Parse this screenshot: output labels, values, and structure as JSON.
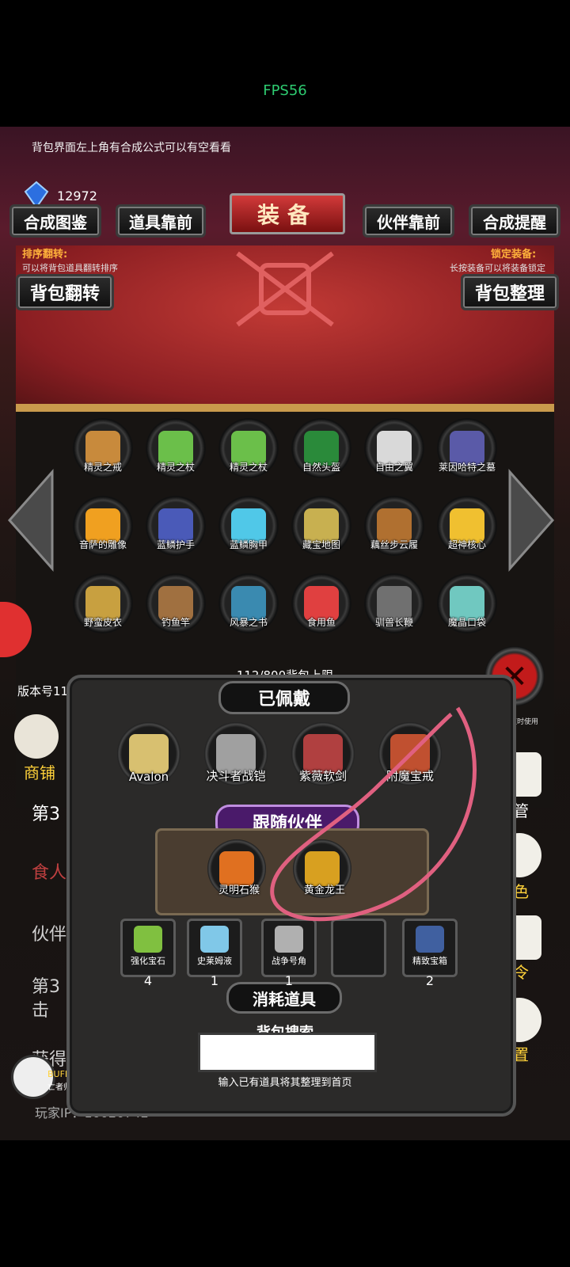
{
  "status_bar": {
    "fps": "FPS56"
  },
  "hint": "背包界面左上角有合成公式可以有空看看",
  "currency": {
    "amount": "12972",
    "icon": "blue-gem-icon"
  },
  "title": "装备",
  "tabs": {
    "recipe": "合成图鉴",
    "items_front": "道具靠前",
    "partners_front": "伙伴靠前",
    "craft_remind": "合成提醒"
  },
  "sort": {
    "left_title": "排序翻转:",
    "left_desc": "可以将背包道具翻转排序",
    "right_title": "锁定装备:",
    "right_desc": "长按装备可以将装备锁定",
    "flip_button": "背包翻转",
    "tidy_button": "背包整理"
  },
  "inventory": [
    {
      "name": "精灵之戒",
      "icon": "ring-icon",
      "color": "#c88a3c"
    },
    {
      "name": "精灵之杖",
      "icon": "staff-icon",
      "color": "#6bbf4a"
    },
    {
      "name": "精灵之杖",
      "icon": "staff-icon",
      "color": "#6bbf4a"
    },
    {
      "name": "自然头盔",
      "icon": "helmet-icon",
      "color": "#2a8a3a"
    },
    {
      "name": "自由之翼",
      "icon": "wings-icon",
      "color": "#d9d9d9"
    },
    {
      "name": "莱因哈特之墓",
      "icon": "tomb-icon",
      "color": "#5a5aa8"
    },
    {
      "name": "音萨的雕像",
      "icon": "statue-icon",
      "color": "#f0a020"
    },
    {
      "name": "蓝鳞护手",
      "icon": "gauntlet-icon",
      "color": "#4a5ab8"
    },
    {
      "name": "蓝鳞胸甲",
      "icon": "chestplate-icon",
      "color": "#50c8e8"
    },
    {
      "name": "藏宝地图",
      "icon": "map-icon",
      "color": "#c8b050"
    },
    {
      "name": "藕丝步云履",
      "icon": "boots-icon",
      "color": "#b07030"
    },
    {
      "name": "超神核心",
      "icon": "core-icon",
      "color": "#f0c030"
    },
    {
      "name": "野蛮皮衣",
      "icon": "leather-coat-icon",
      "color": "#c8a040"
    },
    {
      "name": "钓鱼竿",
      "icon": "fishing-rod-icon",
      "color": "#a07040"
    },
    {
      "name": "风暴之书",
      "icon": "book-icon",
      "color": "#3a8ab0"
    },
    {
      "name": "食用鱼",
      "icon": "fish-icon",
      "color": "#e04040"
    },
    {
      "name": "驯兽长鞭",
      "icon": "whip-icon",
      "color": "#707070"
    },
    {
      "name": "魔晶口袋",
      "icon": "pouch-icon",
      "color": "#70c8c0"
    }
  ],
  "capacity": "112/800背包上限",
  "equipped": {
    "header": "已佩戴",
    "items": [
      {
        "name": "Avalon",
        "icon": "sword-icon",
        "color": "#d8c070"
      },
      {
        "name": "决斗者战铠",
        "icon": "armor-icon",
        "color": "#a0a0a0"
      },
      {
        "name": "紫薇软剑",
        "icon": "soft-sword-icon",
        "color": "#b04040"
      },
      {
        "name": "附魔宝戒",
        "icon": "enchanted-ring-icon",
        "color": "#c05030"
      }
    ]
  },
  "companions": {
    "header": "跟随伙伴",
    "items": [
      {
        "name": "灵明石猴",
        "icon": "monkey-icon",
        "color": "#e07020"
      },
      {
        "name": "黄金龙王",
        "icon": "golden-dragon-icon",
        "color": "#d8a020"
      }
    ]
  },
  "consumables": {
    "header": "消耗道具",
    "items": [
      {
        "name": "强化宝石",
        "count": "4",
        "icon": "green-gem-icon",
        "color": "#80c040"
      },
      {
        "name": "史莱姆液",
        "count": "1",
        "icon": "potion-icon",
        "color": "#80c8e8"
      },
      {
        "name": "战争号角",
        "count": "1",
        "icon": "horn-icon",
        "color": "#b0b0b0"
      },
      {
        "name": "",
        "count": "",
        "icon": "",
        "color": "#1c1c1c"
      },
      {
        "name": "精致宝箱",
        "count": "2",
        "icon": "chest-icon",
        "color": "#4060a0"
      }
    ]
  },
  "search": {
    "label": "背包搜索",
    "hint": "输入已有道具将其整理到首页"
  },
  "sidebar_left": {
    "shop": "商铺",
    "version": "版本号11"
  },
  "sidebar_right": {
    "manage": "托管",
    "role": "角色",
    "command": "口令",
    "settings": "设置",
    "bag_small": "共数值时使用"
  },
  "background_log": [
    "第3",
    "食人魔",
    "伙伴",
    "第3",
    "击",
    "获得女孩送你的一"
  ],
  "buff": {
    "label": "BUFF",
    "sub": "亡者归来"
  },
  "player_ip": "玩家IP：16020742"
}
